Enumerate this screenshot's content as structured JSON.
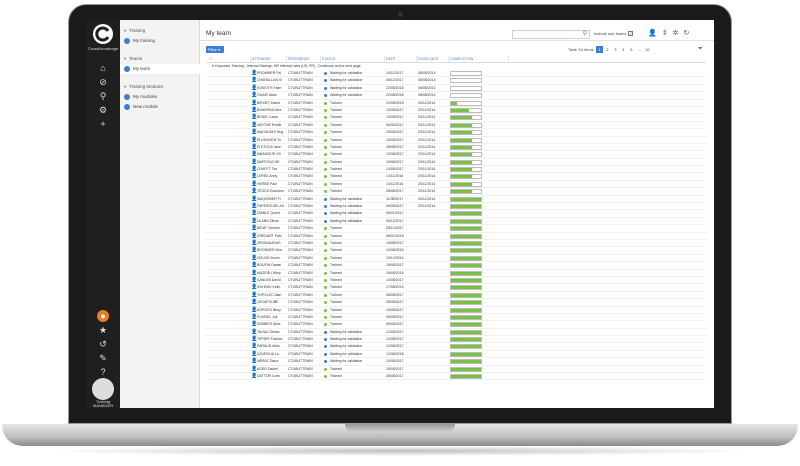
{
  "app": {
    "brand": "CrossKnowledge",
    "footer": "Training MANAGER"
  },
  "nav": {
    "sections": [
      {
        "head": "Training",
        "items": [
          {
            "label": "My training",
            "selected": false
          }
        ]
      },
      {
        "head": "Teams",
        "items": [
          {
            "label": "My team",
            "selected": true
          }
        ]
      },
      {
        "head": "Training Modules",
        "items": [
          {
            "label": "My modules",
            "selected": false
          },
          {
            "label": "New module",
            "selected": false
          }
        ]
      }
    ]
  },
  "header": {
    "title": "My team",
    "search_placeholder": "",
    "subteam_label": "Include sub teams",
    "filter_label": "Filter"
  },
  "pager": {
    "label": "Total: 54 items",
    "pages": [
      "1",
      "2",
      "3",
      "4",
      "5",
      "...",
      "10"
    ],
    "current": "1"
  },
  "table": {
    "columns": [
      "Attendee",
      "Reference",
      "Status",
      "Date",
      "Fixed date",
      "Completion"
    ],
    "group": "Corporate Training - Internal Savings: HR Internal rules (US, FR) - Continues as the next page",
    "rows": [
      {
        "name": "PROMMER Fel",
        "ref": "CTUBUTTRAIN",
        "status": "Waiting for validation",
        "color": "#3a7ed6",
        "date": "14/11/2017",
        "fixed": "08/08/2014",
        "completion": 0
      },
      {
        "name": "CHARALLAN Vi",
        "ref": "CTUBUTTRAIN",
        "status": "Waiting for validation",
        "color": "#3a7ed6",
        "date": "08/12/2017",
        "fixed": "08/08/2014",
        "completion": 0
      },
      {
        "name": "KOSEITH Fabri",
        "ref": "CTUBUTTRAIN",
        "status": "Waiting for validation",
        "color": "#3a7ed6",
        "date": "22/08/2018",
        "fixed": "08/08/2014",
        "completion": 0
      },
      {
        "name": "GUAIR Alain",
        "ref": "CTUBUTTRAIN",
        "status": "Waiting for validation",
        "color": "#3a7ed6",
        "date": "22/08/2018",
        "fixed": "08/08/2014",
        "completion": 0
      },
      {
        "name": "BIRGET David",
        "ref": "CTUBUTTRAIN",
        "status": "Trained",
        "color": "#7ac143",
        "date": "22/08/2018",
        "fixed": "20/11/2014",
        "completion": 0.2
      },
      {
        "name": "BANERNA Alex",
        "ref": "CTUBUTTRAIN",
        "status": "Trained",
        "color": "#7ac143",
        "date": "13/08/2017",
        "fixed": "20/11/2014",
        "completion": 0.6
      },
      {
        "name": "BRIDE Lucas",
        "ref": "CTUBUTTRAIN",
        "status": "Trained",
        "color": "#7ac143",
        "date": "13/08/2017",
        "fixed": "20/11/2014",
        "completion": 0.7
      },
      {
        "name": "VAYCHE Emilie",
        "ref": "CTUBUTTRAIN",
        "status": "Trained",
        "color": "#7ac143",
        "date": "06/06/2017",
        "fixed": "20/11/2014",
        "completion": 0.7
      },
      {
        "name": "MAGAUDUI Hug",
        "ref": "CTUBUTTRAIN",
        "status": "Trained",
        "color": "#7ac143",
        "date": "15/08/2017",
        "fixed": "20/11/2014",
        "completion": 0.7
      },
      {
        "name": "ELUHAGEN Yo",
        "ref": "CTUBUTTRAIN",
        "status": "Trained",
        "color": "#7ac143",
        "date": "13/08/2017",
        "fixed": "20/11/2014",
        "completion": 0.7
      },
      {
        "name": "FLETOUX Iane",
        "ref": "CTUBUTTRAIN",
        "status": "Trained",
        "color": "#7ac143",
        "date": "28/08/2017",
        "fixed": "20/11/2014",
        "completion": 0.7
      },
      {
        "name": "MAAMOUR Oli",
        "ref": "CTUBUTTRAIN",
        "status": "Trained",
        "color": "#7ac143",
        "date": "13/08/2017",
        "fixed": "20/11/2014",
        "completion": 0.7
      },
      {
        "name": "MARTOUCHE",
        "ref": "CTUBUTTRAIN",
        "status": "Trained",
        "color": "#7ac143",
        "date": "19/08/2017",
        "fixed": "20/11/2014",
        "completion": 0.7
      },
      {
        "name": "CRAFFT Tim",
        "ref": "CTUBUTTRAIN",
        "status": "Trained",
        "color": "#7ac143",
        "date": "14/08/2017",
        "fixed": "20/11/2014",
        "completion": 0.7
      },
      {
        "name": "LEREE Andy",
        "ref": "CTUBUTTRAIN",
        "status": "Trained",
        "color": "#7ac143",
        "date": "14/11/2016",
        "fixed": "20/11/2014",
        "completion": 0.7
      },
      {
        "name": "HERBE Paul",
        "ref": "CTUBUTTRAIN",
        "status": "Trained",
        "color": "#7ac143",
        "date": "14/11/2016",
        "fixed": "20/11/2014",
        "completion": 0.7
      },
      {
        "name": "TEGDO Brandon",
        "ref": "CTUBUTTRAIN",
        "status": "Trained",
        "color": "#7ac143",
        "date": "28/08/2017",
        "fixed": "20/11/2014",
        "completion": 0.7
      },
      {
        "name": "MAQUINIER Fl",
        "ref": "CTUBUTTRAIN",
        "status": "Waiting for validation",
        "color": "#3a7ed6",
        "date": "11/08/2017",
        "fixed": "20/11/2014",
        "completion": 1
      },
      {
        "name": "FAPEROUDE Ad",
        "ref": "CTUBUTTRAIN",
        "status": "Waiting for validation",
        "color": "#3a7ed6",
        "date": "06/08/2017",
        "fixed": "20/11/2014",
        "completion": 1
      },
      {
        "name": "DIBBLE Quent",
        "ref": "CTUBUTTRAIN",
        "status": "Waiting for validation",
        "color": "#3a7ed6",
        "date": "05/01/2017",
        "fixed": "",
        "completion": 1
      },
      {
        "name": "ULANN Olivia",
        "ref": "CTUBUTTRAIN",
        "status": "Waiting for validation",
        "color": "#3a7ed6",
        "date": "06/12/2017",
        "fixed": "",
        "completion": 1
      },
      {
        "name": "BIDAT Vincent",
        "ref": "CTUBUTTRAIN",
        "status": "Trained",
        "color": "#7ac143",
        "date": "28/12/2017",
        "fixed": "",
        "completion": 1
      },
      {
        "name": "CREDART Fabi",
        "ref": "CTUBUTTRAIN",
        "status": "Trained",
        "color": "#7ac143",
        "date": "08/01/2018",
        "fixed": "",
        "completion": 1
      },
      {
        "name": "ZIROBAUEIAS",
        "ref": "CTUBUTTRAIN",
        "status": "Trained",
        "color": "#7ac143",
        "date": "15/08/2017",
        "fixed": "",
        "completion": 1
      },
      {
        "name": "BRONNER Bria",
        "ref": "CTUBUTTRAIN",
        "status": "Trained",
        "color": "#7ac143",
        "date": "10/08/2016",
        "fixed": "",
        "completion": 1
      },
      {
        "name": "HOUVE Bruno",
        "ref": "CTUBUTTRAIN",
        "status": "Trained",
        "color": "#7ac143",
        "date": "13/12/2016",
        "fixed": "",
        "completion": 1
      },
      {
        "name": "BOUFIN Daniel",
        "ref": "CTUBUTTRAIN",
        "status": "Trained",
        "color": "#7ac143",
        "date": "15/08/2017",
        "fixed": "",
        "completion": 1
      },
      {
        "name": "MAZERU Wiep",
        "ref": "CTUBUTTRAIN",
        "status": "Trained",
        "color": "#7ac143",
        "date": "19/08/2016",
        "fixed": "",
        "completion": 1
      },
      {
        "name": "SANLEB David",
        "ref": "CTUBUTTRAIN",
        "status": "Trained",
        "color": "#7ac143",
        "date": "13/08/2017",
        "fixed": "",
        "completion": 1
      },
      {
        "name": "SAYEMU Kelin",
        "ref": "CTUBUTTRAIN",
        "status": "Trained",
        "color": "#7ac143",
        "date": "17/08/2016",
        "fixed": "",
        "completion": 1
      },
      {
        "name": "TOPOLEC Alan",
        "ref": "CTUBUTTRAIN",
        "status": "Trained",
        "color": "#7ac143",
        "date": "08/08/2017",
        "fixed": "",
        "completion": 1
      },
      {
        "name": "LEGAFOUBE",
        "ref": "CTUBUTTRAIN",
        "status": "Trained",
        "color": "#7ac143",
        "date": "28/08/2017",
        "fixed": "",
        "completion": 1
      },
      {
        "name": "AOPOFO Bhuy",
        "ref": "CTUBUTTRAIN",
        "status": "Trained",
        "color": "#7ac143",
        "date": "15/08/2017",
        "fixed": "",
        "completion": 1
      },
      {
        "name": "FOUDEL Juli",
        "ref": "CTUBUTTRAIN",
        "status": "Trained",
        "color": "#7ac143",
        "date": "08/08/2017",
        "fixed": "",
        "completion": 1
      },
      {
        "name": "SEBBIER Alice",
        "ref": "CTUBUTTRAIN",
        "status": "Trained",
        "color": "#7ac143",
        "date": "05/08/2017",
        "fixed": "",
        "completion": 1
      },
      {
        "name": "TAHAU Sebas",
        "ref": "CTUBUTTRAIN",
        "status": "Waiting for validation",
        "color": "#3a7ed6",
        "date": "12/08/2017",
        "fixed": "",
        "completion": 1
      },
      {
        "name": "TIPHER Fabrice",
        "ref": "CTUBUTTRAIN",
        "status": "Waiting for validation",
        "color": "#3a7ed6",
        "date": "12/08/2017",
        "fixed": "",
        "completion": 1
      },
      {
        "name": "PARAUD Alain",
        "ref": "CTUBUTTRAIN",
        "status": "Waiting for validation",
        "color": "#3a7ed6",
        "date": "12/08/2017",
        "fixed": "",
        "completion": 1
      },
      {
        "name": "AZUROUA Lu",
        "ref": "CTUBUTTRAIN",
        "status": "Waiting for validation",
        "color": "#3a7ed6",
        "date": "12/08/2018",
        "fixed": "",
        "completion": 1
      },
      {
        "name": "MEBLE Gaux",
        "ref": "CTUBUTTRAIN",
        "status": "Waiting for validation",
        "color": "#3a7ed6",
        "date": "10/08/2017",
        "fixed": "",
        "completion": 1
      },
      {
        "name": "AGER Daniel",
        "ref": "CTUBUTTRAIN",
        "status": "Trained",
        "color": "#7ac143",
        "date": "15/08/2017",
        "fixed": "",
        "completion": 1
      },
      {
        "name": "DATTOR Coec",
        "ref": "CTUBUTTRAIN",
        "status": "Trained",
        "color": "#7ac143",
        "date": "28/08/2017",
        "fixed": "",
        "completion": 1
      }
    ]
  }
}
